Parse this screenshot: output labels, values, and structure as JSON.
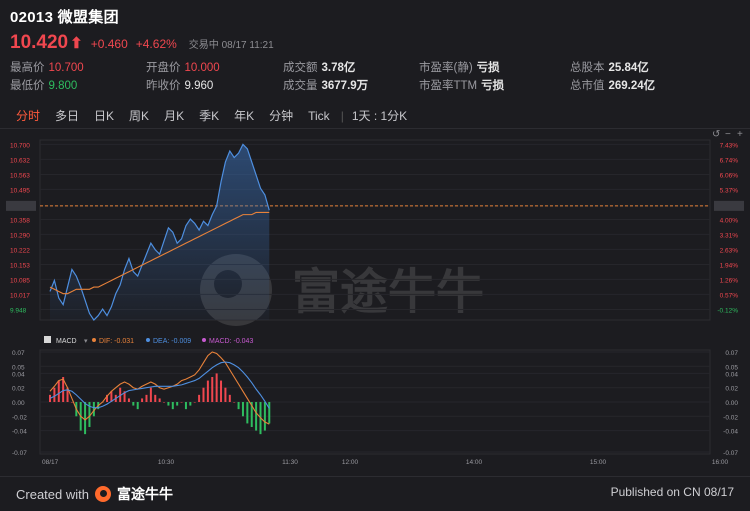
{
  "header": {
    "title": "02013 微盟集团",
    "price": "10.420",
    "change": "+0.460",
    "change_pct": "+4.62%",
    "status": "交易中 08/17 11:21"
  },
  "stats": [
    {
      "label": "最高价",
      "value": "10.700",
      "style": "red"
    },
    {
      "label": "开盘价",
      "value": "10.000",
      "style": "red"
    },
    {
      "label": "成交额",
      "value": "3.78亿",
      "style": "bold"
    },
    {
      "label": "市盈率(静)",
      "value": "亏损",
      "style": "bold"
    },
    {
      "label": "总股本",
      "value": "25.84亿",
      "style": "bold"
    },
    {
      "label": "最低价",
      "value": "9.800",
      "style": "green"
    },
    {
      "label": "昨收价",
      "value": "9.960",
      "style": ""
    },
    {
      "label": "成交量",
      "value": "3677.9万",
      "style": "bold"
    },
    {
      "label": "市盈率TTM",
      "value": "亏损",
      "style": "bold"
    },
    {
      "label": "总市值",
      "value": "269.24亿",
      "style": "bold"
    }
  ],
  "tabs": [
    "分时",
    "多日",
    "日K",
    "周K",
    "月K",
    "季K",
    "年K",
    "分钟",
    "Tick"
  ],
  "active_tab": "分时",
  "range_label": "1天 : 1分K",
  "watermark": "富途牛牛",
  "macd_legend": {
    "name": "MACD",
    "dif": "DIF: -0.031",
    "dea": "DEA: -0.009",
    "macd": "MACD: -0.043"
  },
  "footer": {
    "created": "Created with",
    "brand": "富途牛牛",
    "published": "Published on CN 08/17"
  },
  "colors": {
    "up": "#f0474f",
    "down": "#2ebd5f",
    "accent": "#ff5a3c",
    "price_line": "#4e8fe0",
    "avg_line": "#e8823a",
    "dif": "#e8823a",
    "dea": "#4e8fe0"
  },
  "chart_data": [
    {
      "type": "line",
      "title": "",
      "prev_close": 9.96,
      "current": 10.42,
      "y_ticks": [
        "10.700",
        "10.632",
        "10.563",
        "10.495",
        "10.420",
        "10.358",
        "10.290",
        "10.222",
        "10.153",
        "10.085",
        "10.017",
        "9.948"
      ],
      "y_tick_values": [
        10.7,
        10.632,
        10.563,
        10.495,
        10.42,
        10.358,
        10.29,
        10.222,
        10.153,
        10.085,
        10.017,
        9.948
      ],
      "pct_ticks": [
        "7.43%",
        "6.74%",
        "6.06%",
        "5.37%",
        "4.62%",
        "4.00%",
        "3.31%",
        "2.63%",
        "1.94%",
        "1.26%",
        "0.57%",
        "-0.12%"
      ],
      "ylim": [
        9.9,
        10.72
      ],
      "x_labels": [
        "08/17",
        "10:30",
        "11:30",
        "12:00",
        "14:00",
        "15:00",
        "16:00"
      ],
      "series": [
        {
          "name": "",
          "values": [
            10.03,
            10.08,
            10.0,
            9.97,
            10.05,
            10.13,
            10.1,
            10.05,
            9.99,
            9.93,
            9.9,
            9.92,
            9.95,
            9.92,
            9.96,
            10.02,
            10.06,
            10.13,
            10.18,
            10.12,
            10.1,
            10.15,
            10.2,
            10.25,
            10.22,
            10.2,
            10.26,
            10.32,
            10.3,
            10.25,
            10.27,
            10.33,
            10.36,
            10.34,
            10.31,
            10.35,
            10.33,
            10.38,
            10.42,
            10.53,
            10.62,
            10.67,
            10.64,
            10.66,
            10.7,
            10.68,
            10.62,
            10.56,
            10.5,
            10.47,
            10.4
          ]
        },
        {
          "name": "",
          "values": [
            10.05,
            10.04,
            10.03,
            10.02,
            10.02,
            10.03,
            10.04,
            10.04,
            10.04,
            10.04,
            10.05,
            10.05,
            10.06,
            10.07,
            10.08,
            10.09,
            10.1,
            10.11,
            10.12,
            10.13,
            10.14,
            10.15,
            10.16,
            10.17,
            10.18,
            10.19,
            10.2,
            10.21,
            10.22,
            10.23,
            10.24,
            10.25,
            10.26,
            10.27,
            10.28,
            10.29,
            10.3,
            10.31,
            10.32,
            10.33,
            10.34,
            10.35,
            10.36,
            10.37,
            10.38,
            10.38,
            10.38,
            10.39,
            10.39,
            10.39,
            10.39
          ]
        }
      ]
    },
    {
      "type": "bar",
      "title": "MACD",
      "ylim": [
        -0.07,
        0.07
      ],
      "y_ticks": [
        "0.07",
        "0.05",
        "0.04",
        "0.02",
        "0.00",
        "-0.02",
        "-0.04",
        "-0.07"
      ],
      "y_tick_values": [
        0.07,
        0.05,
        0.04,
        0.02,
        0.0,
        -0.02,
        -0.04,
        -0.07
      ],
      "series": [
        {
          "name": "MACD",
          "values": [
            0.01,
            0.02,
            0.03,
            0.035,
            0.02,
            0.0,
            -0.02,
            -0.04,
            -0.045,
            -0.035,
            -0.02,
            -0.01,
            0.0,
            0.01,
            0.015,
            0.01,
            0.02,
            0.015,
            0.005,
            -0.005,
            -0.01,
            0.005,
            0.01,
            0.02,
            0.01,
            0.005,
            0.0,
            -0.005,
            -0.01,
            -0.005,
            0.0,
            -0.01,
            -0.005,
            0.0,
            0.01,
            0.02,
            0.03,
            0.035,
            0.04,
            0.03,
            0.02,
            0.01,
            0.0,
            -0.01,
            -0.02,
            -0.03,
            -0.035,
            -0.04,
            -0.045,
            -0.04,
            -0.03
          ]
        },
        {
          "name": "DIF",
          "values": [
            0.015,
            0.022,
            0.03,
            0.032,
            0.02,
            0.005,
            -0.01,
            -0.02,
            -0.025,
            -0.02,
            -0.012,
            -0.005,
            0.0,
            0.008,
            0.015,
            0.02,
            0.025,
            0.028,
            0.025,
            0.02,
            0.018,
            0.022,
            0.025,
            0.028,
            0.025,
            0.02,
            0.018,
            0.02,
            0.022,
            0.025,
            0.03,
            0.032,
            0.035,
            0.038,
            0.045,
            0.055,
            0.065,
            0.07,
            0.068,
            0.062,
            0.055,
            0.045,
            0.035,
            0.025,
            0.015,
            0.005,
            -0.005,
            -0.015,
            -0.022,
            -0.028,
            -0.031
          ]
        },
        {
          "name": "DEA",
          "values": [
            0.005,
            0.008,
            0.012,
            0.016,
            0.017,
            0.015,
            0.01,
            0.004,
            -0.002,
            -0.006,
            -0.008,
            -0.008,
            -0.006,
            -0.003,
            0.001,
            0.005,
            0.009,
            0.013,
            0.016,
            0.017,
            0.018,
            0.019,
            0.02,
            0.021,
            0.022,
            0.022,
            0.022,
            0.022,
            0.022,
            0.023,
            0.024,
            0.026,
            0.028,
            0.03,
            0.033,
            0.038,
            0.043,
            0.048,
            0.052,
            0.055,
            0.056,
            0.055,
            0.052,
            0.048,
            0.042,
            0.035,
            0.027,
            0.018,
            0.01,
            0.001,
            -0.009
          ]
        }
      ]
    }
  ]
}
